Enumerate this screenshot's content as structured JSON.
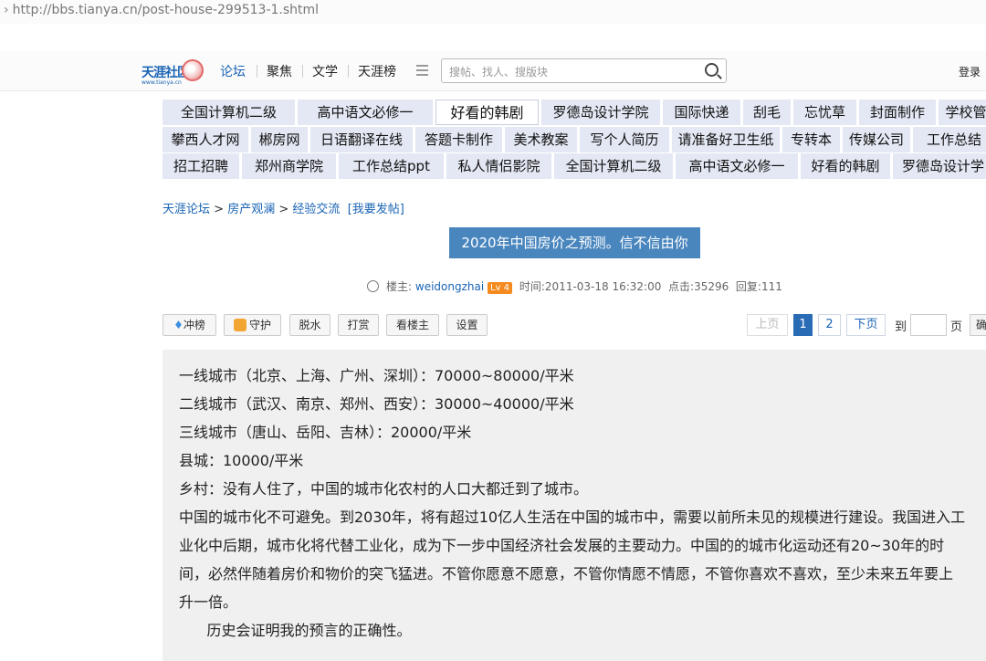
{
  "browser": {
    "url": "http://bbs.tianya.cn/post-house-299513-1.shtml"
  },
  "header": {
    "logo_text": "天涯社区",
    "logo_url": "www.tianya.cn",
    "nav": [
      "论坛",
      "聚焦",
      "文学",
      "天涯榜"
    ],
    "search_placeholder": "搜帖、找人、搜版块",
    "login": "登录"
  },
  "link_rows": [
    [
      "全国计算机二级",
      "高中语文必修一",
      "好看的韩剧",
      "罗德岛设计学院",
      "国际快递",
      "刮毛",
      "忘忧草",
      "封面制作",
      "学校管"
    ],
    [
      "攀西人才网",
      "郴房网",
      "日语翻译在线",
      "答题卡制作",
      "美术教案",
      "写个人简历",
      "请准备好卫生纸",
      "专转本",
      "传媒公司",
      "工作总结"
    ],
    [
      "招工招聘",
      "郑州商学院",
      "工作总结ppt",
      "私人情侣影院",
      "全国计算机二级",
      "高中语文必修一",
      "好看的韩剧",
      "罗德岛设计学"
    ]
  ],
  "breadcrumb": {
    "items": [
      "天涯论坛",
      "房产观澜",
      "经验交流"
    ],
    "separator": ">",
    "action": "[我要发帖]"
  },
  "post_title": "2020年中国房价之预测。信不信由你",
  "meta": {
    "author_label": "楼主:",
    "author": "weidongzhai",
    "level": "Lv 4",
    "time_label": "时间:",
    "time": "2011-03-18 16:32:00",
    "clicks_label": "点击:",
    "clicks": "35296",
    "replies_label": "回复:",
    "replies": "111"
  },
  "actions": {
    "rank": "冲榜",
    "guard": "守护",
    "dehydrate": "脱水",
    "reward": "打赏",
    "only_author": "看楼主",
    "settings": "设置"
  },
  "pagination": {
    "prev": "上页",
    "pages": [
      "1",
      "2"
    ],
    "current": "1",
    "next": "下页",
    "goto_label": "到",
    "page_label": "页",
    "confirm": "确"
  },
  "post_lines": [
    "一线城市（北京、上海、广州、深圳）：70000~80000/平米",
    "二线城市（武汉、南京、郑州、西安）：30000~40000/平米",
    "三线城市（唐山、岳阳、吉林）：20000/平米",
    "县城：10000/平米",
    "乡村：没有人住了，中国的城市化农村的人口大都迁到了城市。",
    "中国的城市化不可避免。到2030年，将有超过10亿人生活在中国的城市中，需要以前所未见的规模进行建设。我国进入工",
    "业化中后期，城市化将代替工业化，成为下一步中国经济社会发展的主要动力。中国的的城市化运动还有20~30年的时",
    "间，必然伴随着房价和物价的突飞猛进。不管你愿意不愿意，不管你情愿不情愿，不管你喜欢不喜欢，至少未来五年要上",
    "升一倍。",
    "      历史会证明我的预言的正确性。"
  ]
}
